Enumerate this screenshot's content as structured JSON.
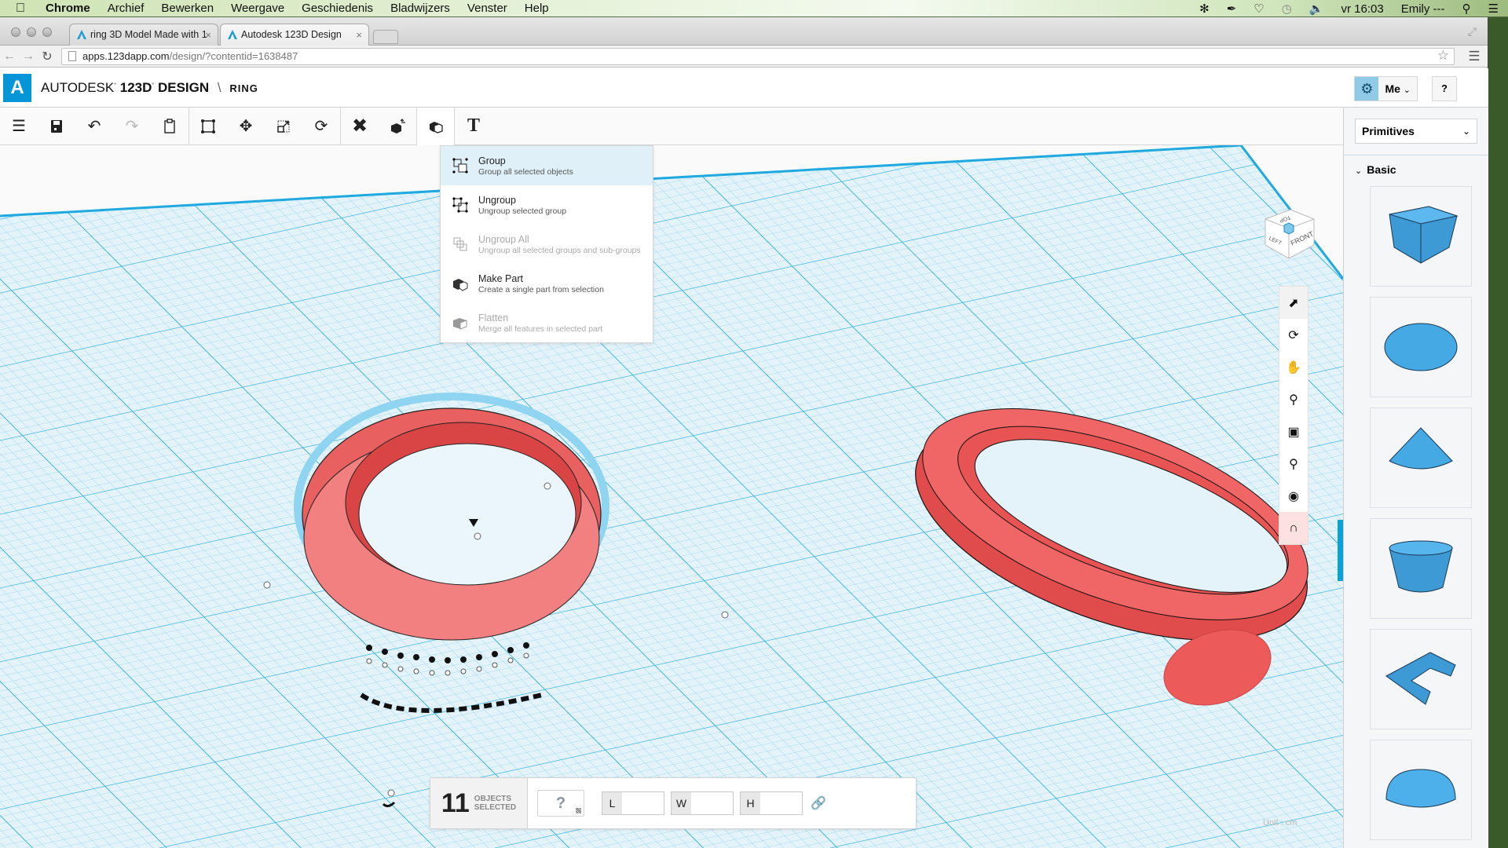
{
  "os_menubar": {
    "app_name": "Chrome",
    "menus": [
      "Archief",
      "Bewerken",
      "Weergave",
      "Geschiedenis",
      "Bladwijzers",
      "Venster",
      "Help"
    ],
    "clock": "vr 16:03",
    "user": "Emily ---",
    "status_icons": [
      "bluetooth-icon",
      "pen-icon",
      "wifi-icon",
      "time-machine-icon",
      "volume-icon"
    ]
  },
  "browser": {
    "tabs": [
      {
        "title": "ring 3D Model Made with 1",
        "active": false
      },
      {
        "title": "Autodesk 123D Design",
        "active": true
      }
    ],
    "url_host": "apps.123dapp.com",
    "url_path": "/design/?contentid=1638487"
  },
  "app": {
    "brand_prefix": "AUTODESK",
    "brand_product": "123D",
    "brand_suffix": "DESIGN",
    "separator": "\\",
    "project_name": "RING",
    "account_label": "Me",
    "help_label": "?",
    "accent_color": "#0696d7",
    "toolbar": {
      "groups": [
        [
          "menu",
          "save",
          "undo",
          "redo",
          "paste"
        ],
        [
          "transform",
          "move",
          "scale",
          "rotate"
        ],
        [
          "construct",
          "modify"
        ],
        [
          "group",
          "text"
        ]
      ],
      "active": "group",
      "text_label": "T"
    },
    "group_menu": [
      {
        "title": "Group",
        "subtitle": "Group all selected objects",
        "enabled": true,
        "highlighted": true
      },
      {
        "title": "Ungroup",
        "subtitle": "Ungroup selected group",
        "enabled": true,
        "highlighted": false
      },
      {
        "title": "Ungroup All",
        "subtitle": "Ungroup all selected groups and sub-groups",
        "enabled": false,
        "highlighted": false
      },
      {
        "title": "Make Part",
        "subtitle": "Create a single part from selection",
        "enabled": true,
        "highlighted": false
      },
      {
        "title": "Flatten",
        "subtitle": "Merge all features in selected part",
        "enabled": false,
        "highlighted": false
      }
    ],
    "viewcube": {
      "top": "TOP",
      "left": "LEFT",
      "front": "FRONT"
    },
    "nav_tools": [
      "select",
      "orbit",
      "pan",
      "zoom",
      "fit",
      "zoom-selected",
      "visibility",
      "snap"
    ],
    "side_panel": {
      "library_select": "Primitives",
      "section": "Basic",
      "primitives": [
        "box",
        "sphere",
        "cone",
        "cylinder",
        "polyline-extrude",
        "hemisphere"
      ]
    },
    "selection": {
      "count": "11",
      "label_line1": "OBJECTS",
      "label_line2": "SELECTED",
      "material": "?",
      "dims": [
        {
          "label": "L",
          "value": ""
        },
        {
          "label": "W",
          "value": ""
        },
        {
          "label": "H",
          "value": ""
        }
      ]
    },
    "unit_label": "Unit : cm",
    "model_color": "#ef5a5a",
    "primitive_color": "#4aa8e0"
  }
}
